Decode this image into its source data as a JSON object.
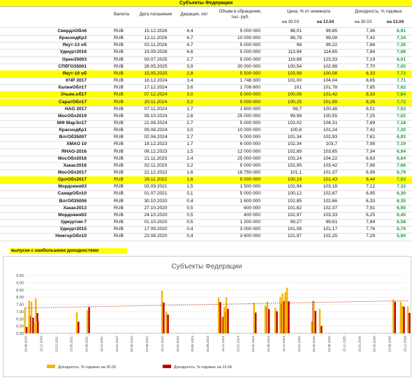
{
  "table": {
    "title": "Субъекты Федерации",
    "headers": {
      "currency": "Валюта",
      "maturity": "Дата погашения",
      "duration": "Дюрация, лет",
      "volume_l1": "Объем в обращении,",
      "volume_l2": "тыс. руб.",
      "price": "Цена, % от номинала",
      "yield": "Доходность, % годовых",
      "date1": "на 30.03",
      "date2": "на 13.04",
      "date3": "на 30.03",
      "date4": "на 13.04"
    },
    "rows": [
      {
        "name": "СвердлОбл6",
        "cur": "RUB",
        "date": "15.12.2026",
        "dur": "4,4",
        "vol": "5 000 000",
        "p1": "98,01",
        "p2": "99,85",
        "y1": "7,36",
        "y2": "6,91"
      },
      {
        "name": "КраснодКр3",
        "cur": "RUB",
        "date": "12.11.2026",
        "dur": "4,7",
        "vol": "10 000 000",
        "p1": "98,79",
        "p2": "99,08",
        "y1": "7,41",
        "y2": "7,34"
      },
      {
        "name": "Якут-13 об",
        "cur": "RUB",
        "date": "02.11.2026",
        "dur": "4,7",
        "vol": "5 000 000",
        "p1": "98",
        "p2": "99,22",
        "y1": "7,68",
        "y2": "7,35"
      },
      {
        "name": "Удмурт2016",
        "cur": "RUB",
        "date": "19.09.2026",
        "dur": "4,6",
        "vol": "5 000 000",
        "p1": "113,94",
        "p2": "114,65",
        "y1": "7,84",
        "y2": "7,68"
      },
      {
        "name": "Орен35003",
        "cur": "RUB",
        "date": "03.07.2025",
        "dur": "2,7",
        "vol": "5 000 000",
        "p1": "119,88",
        "p2": "123,33",
        "y1": "7,19",
        "y2": "6,01"
      },
      {
        "name": "СПбГО35001",
        "cur": "RUB",
        "date": "28.05.2025",
        "dur": "3,9",
        "vol": "30 000 000",
        "p1": "100,54",
        "p2": "102,98",
        "y1": "7,70",
        "y2": "7,05"
      },
      {
        "name": "Якут-10 об",
        "cur": "RUB",
        "date": "15.05.2025",
        "dur": "2,8",
        "vol": "5 500 000",
        "p1": "103,98",
        "p2": "100,08",
        "y1": "6,33",
        "y2": "7,73",
        "hl": true
      },
      {
        "name": "КЧР 2017",
        "cur": "RUB",
        "date": "18.12.2024",
        "dur": "3,4",
        "vol": "1 748 300",
        "p1": "101,00",
        "p2": "104,04",
        "y1": "8,65",
        "y2": "7,71"
      },
      {
        "name": "КалинОбл17",
        "cur": "RUB",
        "date": "17.12.2024",
        "dur": "3,6",
        "vol": "1 706 800",
        "p1": "101",
        "p2": "101,78",
        "y1": "7,85",
        "y2": "7,62"
      },
      {
        "name": "Ульян.об17",
        "cur": "RUB",
        "date": "07.12.2024",
        "dur": "3,0",
        "vol": "5 000 000",
        "p1": "100,06",
        "p2": "101,42",
        "y1": "8,33",
        "y2": "7,84",
        "hl": true
      },
      {
        "name": "СаратОбл17",
        "cur": "RUB",
        "date": "20.11.2024",
        "dur": "3,2",
        "vol": "5 000 000",
        "p1": "100,25",
        "p2": "101,89",
        "y1": "8,26",
        "y2": "7,72",
        "hl": true
      },
      {
        "name": "НАО 2017",
        "cur": "RUB",
        "date": "07.11.2024",
        "dur": "1,7",
        "vol": "1 600 000",
        "p1": "99,7",
        "p2": "100,48",
        "y1": "8,01",
        "y2": "7,53"
      },
      {
        "name": "МосОбл2019",
        "cur": "RUB",
        "date": "08.10.2024",
        "dur": "2,6",
        "vol": "25 000 000",
        "p1": "99,98",
        "p2": "100,55",
        "y1": "7,25",
        "y2": "7,02"
      },
      {
        "name": "МФ МарЭл17",
        "cur": "RUB",
        "date": "21.08.2024",
        "dur": "2,7",
        "vol": "5 000 000",
        "p1": "103,02",
        "p2": "104,31",
        "y1": "7,69",
        "y2": "7,18"
      },
      {
        "name": "КраснодКр1",
        "cur": "RUB",
        "date": "09.08.2024",
        "dur": "3,0",
        "vol": "10 000 000",
        "p1": "100,6",
        "p2": "101,24",
        "y1": "7,42",
        "y2": "7,30"
      },
      {
        "name": "ВлгОб35007",
        "cur": "RUB",
        "date": "02.06.2024",
        "dur": "2,7",
        "vol": "5 000 000",
        "p1": "101,34",
        "p2": "102,93",
        "y1": "7,61",
        "y2": "6,93"
      },
      {
        "name": "ХМАО 10",
        "cur": "RUB",
        "date": "18.12.2023",
        "dur": "1,7",
        "vol": "6 000 000",
        "p1": "102,34",
        "p2": "103,7",
        "y1": "7,98",
        "y2": "7,19"
      },
      {
        "name": "ЯНАО-2016",
        "cur": "RUB",
        "date": "06.12.2023",
        "dur": "1,5",
        "vol": "12 000 000",
        "p1": "102,89",
        "p2": "103,65",
        "y1": "7,34",
        "y2": "6,94"
      },
      {
        "name": "МосОбл2016",
        "cur": "RUB",
        "date": "21.11.2023",
        "dur": "2,4",
        "vol": "25 000 000",
        "p1": "103,24",
        "p2": "104,22",
        "y1": "6,63",
        "y2": "6,64"
      },
      {
        "name": "Хакас2016",
        "cur": "RUB",
        "date": "02.11.2023",
        "dur": "3,2",
        "vol": "5 000 000",
        "p1": "102,95",
        "p2": "103,42",
        "y1": "7,98",
        "y2": "7,66"
      },
      {
        "name": "МосОбл2017",
        "cur": "RUB",
        "date": "22.12.2022",
        "dur": "1,6",
        "vol": "18 750 000",
        "p1": "101,1",
        "p2": "101,37",
        "y1": "6,99",
        "y2": "6,79"
      },
      {
        "name": "ОрлОбл2017",
        "cur": "RUB",
        "date": "26.11.2022",
        "dur": "1,6",
        "vol": "5 000 000",
        "p1": "100,19",
        "p2": "101,43",
        "y1": "8,44",
        "y2": "7,63",
        "hl": true
      },
      {
        "name": "Мордовия03",
        "cur": "RUB",
        "date": "03.09.2021",
        "dur": "1,5",
        "vol": "1 500 000",
        "p1": "102,94",
        "p2": "103,18",
        "y1": "7,12",
        "y2": "7,32"
      },
      {
        "name": "СамарОбл10",
        "cur": "RUB",
        "date": "01.07.2021",
        "dur": "0,1",
        "vol": "5 000 000",
        "p1": "100,12",
        "p2": "102,67",
        "y1": "6,95",
        "y2": "6,30"
      },
      {
        "name": "ВлгОб35006",
        "cur": "RUB",
        "date": "30.10.2020",
        "dur": "0,4",
        "vol": "1 800 000",
        "p1": "102,85",
        "p2": "102,66",
        "y1": "6,33",
        "y2": "6,35"
      },
      {
        "name": "Хакас2013",
        "cur": "RUB",
        "date": "27.10.2020",
        "dur": "0,5",
        "vol": "600 000",
        "p1": "101,82",
        "p2": "102,37",
        "y1": "7,91",
        "y2": "6,90"
      },
      {
        "name": "Мордовия02",
        "cur": "RUB",
        "date": "24.10.2020",
        "dur": "0,5",
        "vol": "400 000",
        "p1": "102,97",
        "p2": "103,33",
        "y1": "6,25",
        "y2": "6,45"
      },
      {
        "name": "Удмуртия-7",
        "cur": "RUB",
        "date": "01.10.2020",
        "dur": "0,5",
        "vol": "1 200 000",
        "p1": "99,27",
        "p2": "99,61",
        "y1": "7,69",
        "y2": "6,58"
      },
      {
        "name": "Удмурт2015",
        "cur": "RUB",
        "date": "17.09.2020",
        "dur": "0,4",
        "vol": "3 000 000",
        "p1": "101,08",
        "p2": "101,17",
        "y1": "7,76",
        "y2": "6,70"
      },
      {
        "name": "НижгорОбл10",
        "cur": "RUB",
        "date": "23.08.2020",
        "dur": "0,4",
        "vol": "3 600 000",
        "p1": "101,97",
        "p2": "102,25",
        "y1": "7,29",
        "y2": "5,94"
      }
    ],
    "note": "выпуски с наибольшими доходностями"
  },
  "colors": {
    "highlight": "#ffff00",
    "series_3003": "#f5b400",
    "series_1304": "#c00000",
    "trend": "#c0392b",
    "yield_new_text": "#1a9641"
  },
  "chart_data": {
    "type": "bar",
    "title": "Субъекты Федерации",
    "x_axis": "date",
    "ylim": [
      5.5,
      9.5
    ],
    "yticks": [
      "5,50",
      "6,00",
      "6,50",
      "7,00",
      "7,50",
      "8,00",
      "8,50",
      "9,00",
      "9,50"
    ],
    "xticks": [
      "23.08.2020",
      "23.11.2020",
      "23.02.2021",
      "23.05.2021",
      "23.08.2021",
      "23.11.2021",
      "23.02.2022",
      "23.05.2022",
      "23.08.2022",
      "23.11.2022",
      "23.02.2023",
      "23.05.2023",
      "23.08.2023",
      "23.11.2023",
      "23.02.2024",
      "23.05.2024",
      "23.08.2024",
      "23.11.2024",
      "23.02.2025",
      "23.05.2025",
      "23.08.2025",
      "23.11.2025",
      "23.02.2026",
      "23.05.2026",
      "23.08.2026",
      "23.11.2026"
    ],
    "grid": true,
    "legend_position": "bottom",
    "trendline": "linear, dotted",
    "series": [
      {
        "name": "Доходность, % годовых на 30.03"
      },
      {
        "name": "Доходность, % годовых на 13.04"
      }
    ],
    "points": [
      {
        "x": "2020-08-23",
        "y1": 7.29,
        "y2": 5.94
      },
      {
        "x": "2020-09-17",
        "y1": 7.76,
        "y2": 6.7
      },
      {
        "x": "2020-10-01",
        "y1": 7.69,
        "y2": 6.58
      },
      {
        "x": "2020-10-24",
        "y1": 6.25,
        "y2": 6.45
      },
      {
        "x": "2020-10-27",
        "y1": 7.91,
        "y2": 6.9
      },
      {
        "x": "2020-10-30",
        "y1": 6.33,
        "y2": 6.35
      },
      {
        "x": "2021-07-01",
        "y1": 6.95,
        "y2": 6.3
      },
      {
        "x": "2021-09-03",
        "y1": 7.12,
        "y2": 7.32
      },
      {
        "x": "2022-11-26",
        "y1": 8.44,
        "y2": 7.63
      },
      {
        "x": "2022-12-22",
        "y1": 6.99,
        "y2": 6.79
      },
      {
        "x": "2023-11-02",
        "y1": 7.98,
        "y2": 7.66
      },
      {
        "x": "2023-11-21",
        "y1": 6.63,
        "y2": 6.64
      },
      {
        "x": "2023-12-06",
        "y1": 7.34,
        "y2": 6.94
      },
      {
        "x": "2023-12-18",
        "y1": 7.98,
        "y2": 7.19
      },
      {
        "x": "2024-06-02",
        "y1": 7.61,
        "y2": 6.93
      },
      {
        "x": "2024-08-09",
        "y1": 7.42,
        "y2": 7.3
      },
      {
        "x": "2024-08-21",
        "y1": 7.69,
        "y2": 7.18
      },
      {
        "x": "2024-10-08",
        "y1": 7.25,
        "y2": 7.02
      },
      {
        "x": "2024-11-07",
        "y1": 8.01,
        "y2": 7.53
      },
      {
        "x": "2024-11-20",
        "y1": 8.26,
        "y2": 7.72
      },
      {
        "x": "2024-12-07",
        "y1": 8.33,
        "y2": 7.84
      },
      {
        "x": "2024-12-17",
        "y1": 7.85,
        "y2": 7.62
      },
      {
        "x": "2024-12-18",
        "y1": 8.65,
        "y2": 7.71
      },
      {
        "x": "2025-05-15",
        "y1": 6.33,
        "y2": 7.73
      },
      {
        "x": "2025-05-28",
        "y1": 7.7,
        "y2": 7.05
      },
      {
        "x": "2025-07-03",
        "y1": 7.19,
        "y2": 6.01
      },
      {
        "x": "2026-09-19",
        "y1": 7.84,
        "y2": 7.68
      },
      {
        "x": "2026-11-02",
        "y1": 7.68,
        "y2": 7.35
      },
      {
        "x": "2026-11-12",
        "y1": 7.41,
        "y2": 7.34
      },
      {
        "x": "2026-12-15",
        "y1": 7.36,
        "y2": 6.91
      }
    ]
  }
}
